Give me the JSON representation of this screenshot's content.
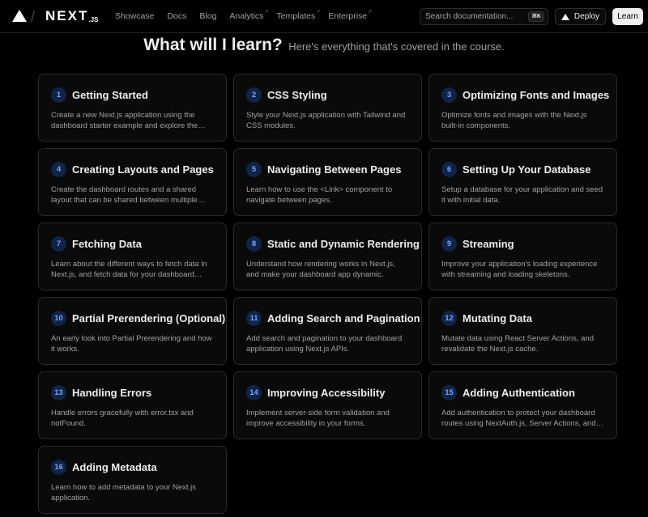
{
  "nav": {
    "logo_text": "NEXT",
    "logo_suffix": ".JS",
    "slash": "/",
    "links": [
      "Showcase",
      "Docs",
      "Blog",
      "Analytics",
      "Templates",
      "Enterprise"
    ],
    "ext_glyph": "↗",
    "search_placeholder": "Search documentation...",
    "search_shortcut": "⌘K",
    "deploy_label": "Deploy",
    "learn_label": "Learn"
  },
  "heading": {
    "title": "What will I learn?",
    "subtitle": "Here's everything that's covered in the course."
  },
  "chapters": [
    {
      "num": "1",
      "title": "Getting Started",
      "desc": "Create a new Next.js application using the dashboard starter example and explore the project."
    },
    {
      "num": "2",
      "title": "CSS Styling",
      "desc": "Style your Next.js application with Tailwind and CSS modules."
    },
    {
      "num": "3",
      "title": "Optimizing Fonts and Images",
      "desc": "Optimize fonts and images with the Next.js built-in components."
    },
    {
      "num": "4",
      "title": "Creating Layouts and Pages",
      "desc": "Create the dashboard routes and a shared layout that can be shared between multiple pages."
    },
    {
      "num": "5",
      "title": "Navigating Between Pages",
      "desc": "Learn how to use the <Link> component to navigate between pages."
    },
    {
      "num": "6",
      "title": "Setting Up Your Database",
      "desc": "Setup a database for your application and seed it with initial data."
    },
    {
      "num": "7",
      "title": "Fetching Data",
      "desc": "Learn about the different ways to fetch data in Next.js, and fetch data for your dashboard page."
    },
    {
      "num": "8",
      "title": "Static and Dynamic Rendering",
      "desc": "Understand how rendering works in Next.js, and make your dashboard app dynamic."
    },
    {
      "num": "9",
      "title": "Streaming",
      "desc": "Improve your application's loading experience with streaming and loading skeletons."
    },
    {
      "num": "10",
      "title": "Partial Prerendering (Optional)",
      "desc": "An early look into Partial Prerendering and how it works."
    },
    {
      "num": "11",
      "title": "Adding Search and Pagination",
      "desc": "Add search and pagination to your dashboard application using Next.js APIs."
    },
    {
      "num": "12",
      "title": "Mutating Data",
      "desc": "Mutate data using React Server Actions, and revalidate the Next.js cache."
    },
    {
      "num": "13",
      "title": "Handling Errors",
      "desc": "Handle errors gracefully with error.tsx and notFound."
    },
    {
      "num": "14",
      "title": "Improving Accessibility",
      "desc": "Implement server-side form validation and improve accessibility in your forms."
    },
    {
      "num": "15",
      "title": "Adding Authentication",
      "desc": "Add authentication to protect your dashboard routes using NextAuth.js, Server Actions, and Middleware."
    },
    {
      "num": "16",
      "title": "Adding Metadata",
      "desc": "Learn how to add metadata to your Next.js application."
    }
  ],
  "colors": {
    "background": "#000000",
    "card_background": "#0a0a0a",
    "badge_background": "#0f2447",
    "badge_text": "#7aa2ff"
  }
}
